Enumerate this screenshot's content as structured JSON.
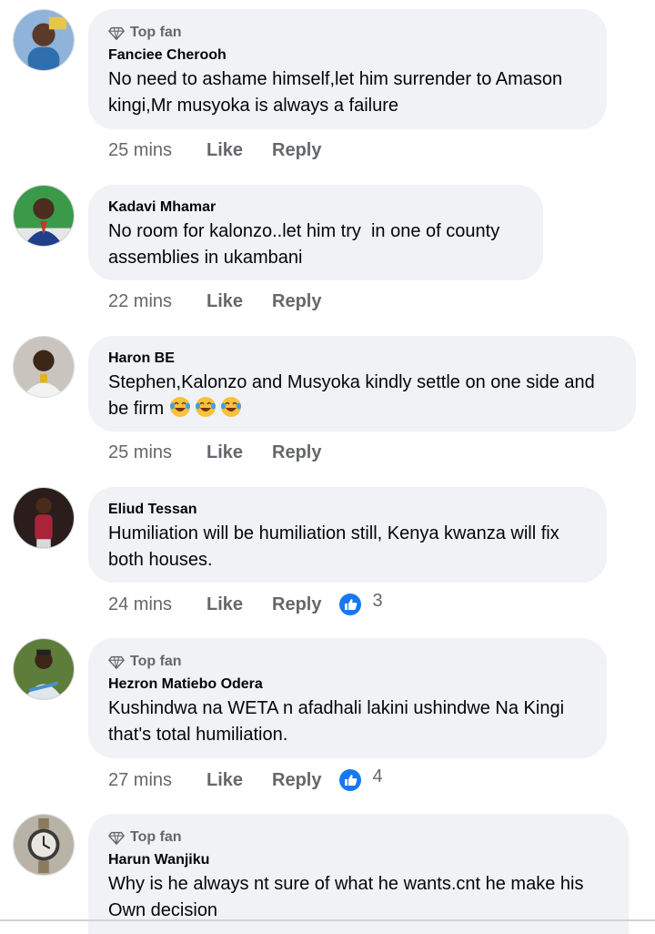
{
  "comments": [
    {
      "top_fan": "Top fan",
      "name": "Fanciee Cherooh",
      "text": "No need to ashame himself,let him surrender to Amason kingi,Mr musyoka is always a failure",
      "time": "25 mins",
      "like": "Like",
      "reply": "Reply"
    },
    {
      "name": "Kadavi Mhamar",
      "text": "No room for kalonzo..let him try  in one of county assemblies in ukambani",
      "time": "22 mins",
      "like": "Like",
      "reply": "Reply"
    },
    {
      "name": "Haron BE",
      "text": "Stephen,Kalonzo and Musyoka kindly settle on one side and be firm",
      "emojis": [
        "laughing-tears-emoji",
        "laughing-tears-emoji",
        "laughing-tears-emoji"
      ],
      "time": "25 mins",
      "like": "Like",
      "reply": "Reply"
    },
    {
      "name": "Eliud Tessan",
      "text": "Humiliation will be humiliation still, Kenya kwanza will fix both houses.",
      "time": "24 mins",
      "like": "Like",
      "reply": "Reply",
      "reaction_icon": "thumbs-up-icon",
      "reaction_count": "3"
    },
    {
      "top_fan": "Top fan",
      "name": "Hezron Matiebo Odera",
      "text": "Kushindwa na WETA n afadhali lakini ushindwe Na Kingi that's total humiliation.",
      "time": "27 mins",
      "like": "Like",
      "reply": "Reply",
      "reaction_icon": "thumbs-up-icon",
      "reaction_count": "4"
    },
    {
      "top_fan": "Top fan",
      "name": "Harun Wanjiku",
      "text": "Why is he always nt sure of what he wants.cnt he make his Own decision"
    }
  ],
  "colors": {
    "bubble": "#f0f2f5",
    "secondary_text": "#65676b",
    "like_blue": "#1877f2"
  }
}
